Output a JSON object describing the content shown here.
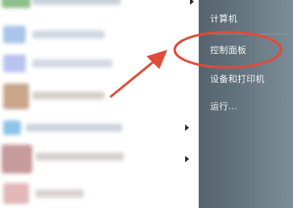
{
  "start_menu": {
    "right_panel": {
      "items": [
        {
          "label": "计算机"
        },
        {
          "label": "控制面板"
        },
        {
          "label": "设备和打印机"
        },
        {
          "label": "运行..."
        }
      ]
    }
  },
  "annotation": {
    "arrow_color": "#e04b3a",
    "highlight": "ellipse-around-control-panel"
  }
}
